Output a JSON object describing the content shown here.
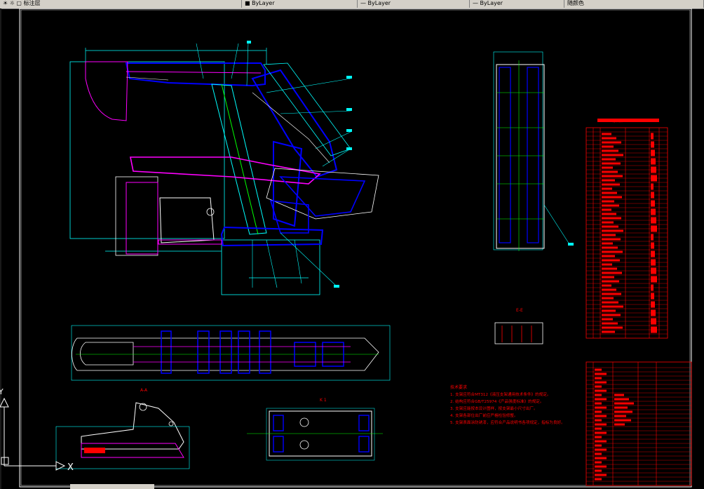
{
  "window": {
    "toolbar_segments": [
      {
        "label": "标注层",
        "icon": "layer-icon"
      },
      {
        "label": "ByLayer",
        "icon": "color-icon"
      },
      {
        "label": "ByLayer",
        "icon": "linetype-icon"
      },
      {
        "label": "ByLayer",
        "icon": "lineweight-icon"
      },
      {
        "label": "随颜色",
        "icon": "plotstyle-icon"
      }
    ]
  },
  "drawing": {
    "section_label_aa": "A-A",
    "section_label_k": "K 1",
    "section_label_ee": "E-E",
    "tech_requirements": {
      "title": "技术要求",
      "lines": [
        "1. 支架应符合MT312《液压支架通用技术条件》的规定。",
        "2. 结构应符合GB/T25974《产品强度标准》的规定。",
        "3. 支架应能按本设计图样，按支架最小尺寸出厂。",
        "4. 支架各部位出厂前应严格检验修整。",
        "5. 支架表面涂防锈漆，应符合产品说明书各项规定，指标为良好。"
      ]
    },
    "parts_table_title": "明细表",
    "ucs_x_label": "X",
    "ucs_y_label": "Y"
  },
  "colors": {
    "background": "#000000",
    "frame": "#ffffff",
    "cyan": "#00ffff",
    "blue": "#0000ff",
    "magenta": "#ff00ff",
    "green": "#00ff00",
    "red": "#ff0000",
    "yellow": "#ffff00"
  }
}
